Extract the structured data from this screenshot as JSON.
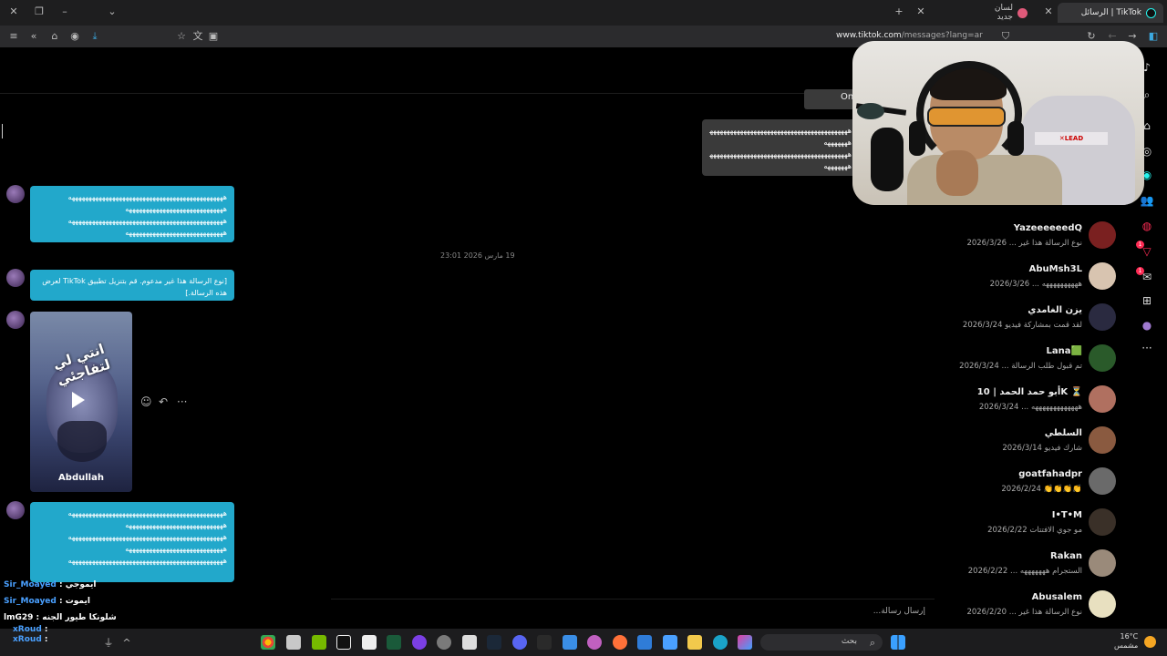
{
  "browser": {
    "tabs": [
      {
        "title": "TikTok | الرسائل",
        "active": true
      },
      {
        "title": "لسان جديد",
        "active": false
      }
    ],
    "url_domain": "www.tiktok.com",
    "url_path": "/messages?lang=ar",
    "new_tab_label": "+",
    "close_label": "✕"
  },
  "chat": {
    "caret": "",
    "on_pill": "On",
    "outgoing_lines": [
      "ههههههههههههههههههههههههههههههههههههههههههههههه",
      "هههههههه",
      "ههههههههههههههههههههههههههههههههههههههههههههههه",
      "هههههههه"
    ],
    "message1_lines": [
      "ههههههههههههههههههههههههههههههههههههههههههههههه",
      "هههههههههههههههههههههههههههههه",
      "ههههههههههههههههههههههههههههههههههههههههههههههه",
      "هههههههههههههههههههههههههههههه"
    ],
    "date_separator": "19 مارس 2026 23:01",
    "unsupported_message": "[نوع الرسالة هذا غير مدعوم. قم بتنزيل تطبيق TikTok لعرض هذه الرسالة.]",
    "video": {
      "overlay_text": "انتي لي لتفاجئي",
      "name": "Abdullah"
    },
    "message3_lines": [
      "ههههههههههههههههههههههههههههههههههههههههههههههه",
      "هههههههههههههههههههههههههههههه",
      "ههههههههههههههههههههههههههههههههههههههههههههههه",
      "هههههههههههههههههههههههههههههه",
      "ههههههههههههههههههههههههههههههههههههههههههههههه"
    ],
    "input_placeholder": "إرسال رسالة..."
  },
  "conversations": [
    {
      "name": "YazeeeeeedQ",
      "sub": "2026/3/26 ... نوع الرسالة هذا غير",
      "color": "#7a2020"
    },
    {
      "name": "AbuMsh3L",
      "sub": "2026/3/26 ... ههههههههههه",
      "color": "#d8c4b0"
    },
    {
      "name": "يزن الغامدي",
      "sub": "2026/3/24 لقد قمت بمشاركة فيديو",
      "color": "#2a2a40"
    },
    {
      "name": "Lana🟩",
      "sub": "2026/3/24 ... تم قبول طلب الرسالة",
      "color": "#2a5a2a"
    },
    {
      "name": "أبو حمد الحمد | 10K ⏳",
      "sub": "2026/3/24 ... هههههههههههههه",
      "color": "#b07060"
    },
    {
      "name": "السلطي",
      "sub": "2026/3/14 شارك فيديو",
      "color": "#8a5a40"
    },
    {
      "name": "goatfahadpr",
      "sub": "2026/2/24 👏👏👏👏",
      "color": "#6a6a6a"
    },
    {
      "name": "I•T•M",
      "sub": "2026/2/22 مو جوي الافتتات",
      "color": "#3a3028"
    },
    {
      "name": "Rakan",
      "sub": "2026/2/22 ... الستجرام هههههههه",
      "color": "#9a8a7a"
    },
    {
      "name": "Abusalem",
      "sub": "2026/2/20 ... نوع الرسالة هذا غير",
      "color": "#e8e0c0"
    }
  ],
  "stream_chat": [
    {
      "user": "Sir_Moayed",
      "msg": "ايموجي"
    },
    {
      "user": "Sir_Moayed",
      "msg": "ايموت"
    },
    {
      "user": "lmG29",
      "msg": "شلونكا طيور الجنه"
    },
    {
      "user": "xRoud",
      "msg": ""
    },
    {
      "user": "xRoud",
      "msg": ""
    }
  ],
  "taskbar": {
    "search_label": "بحث",
    "temperature": "16°C",
    "weather": "مشمس"
  },
  "colors": {
    "bubble_in": "#22a8cb",
    "bubble_out": "#3a3a3a",
    "badge": "#ff2c55",
    "chat_user": "#4aa0ff"
  }
}
